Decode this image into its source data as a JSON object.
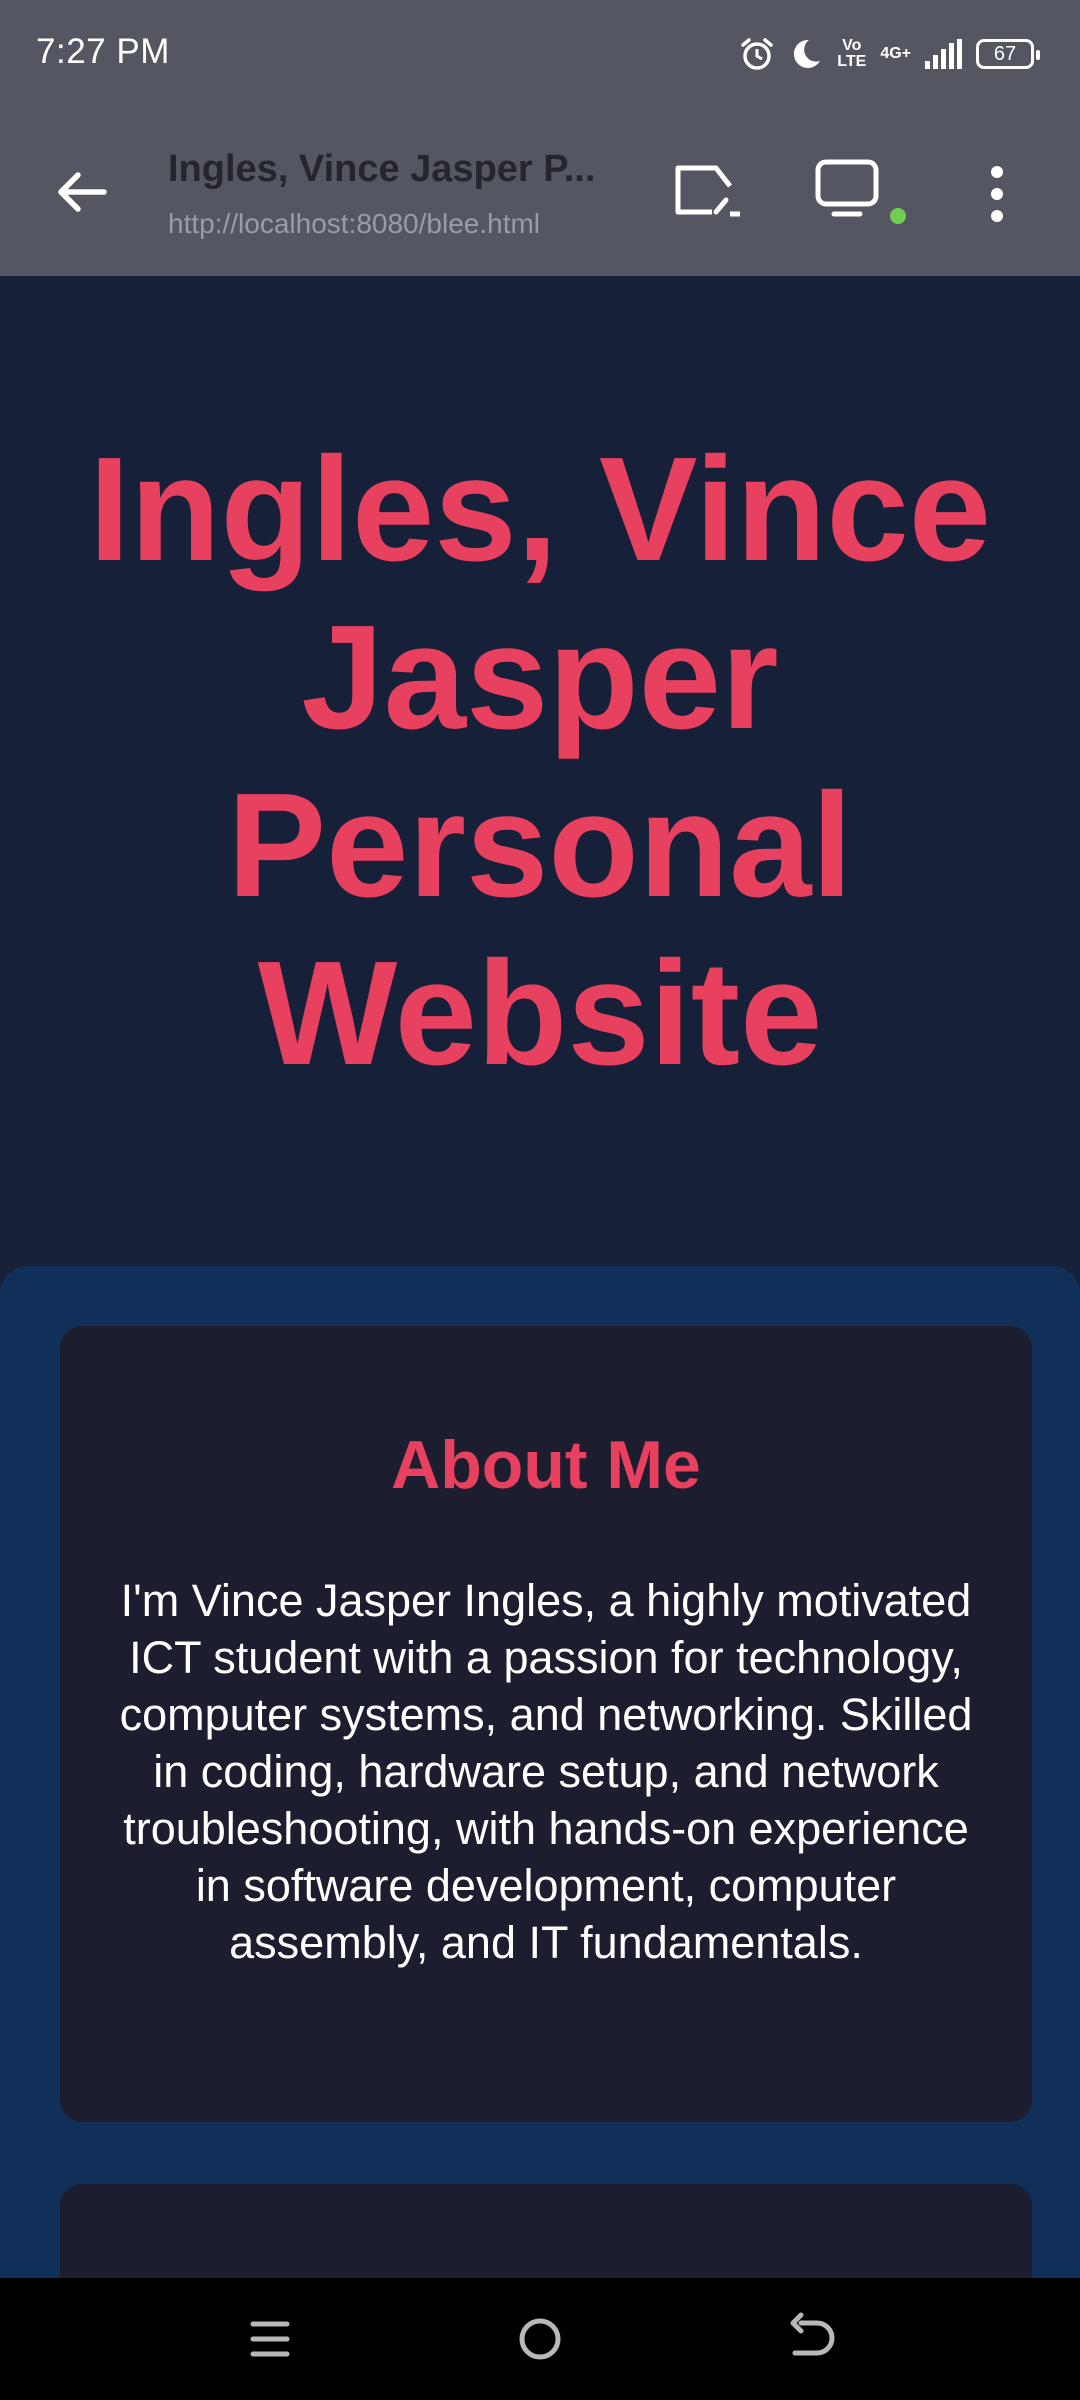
{
  "status_bar": {
    "time": "7:27 PM",
    "volte_top": "Vo",
    "volte_bottom": "LTE",
    "network": "4G+",
    "battery": "67"
  },
  "browser": {
    "title": "Ingles, Vince Jasper P...",
    "url": "http://localhost:8080/blee.html",
    "indicator_color": "#6fce4f"
  },
  "hero": {
    "title": "Ingles, Vince Jasper Personal Website"
  },
  "about": {
    "heading": "About Me",
    "text": "I'm Vince Jasper Ingles, a highly motivated ICT student with a passion for technology, computer systems, and networking. Skilled in coding, hardware setup, and network troubleshooting, with hands-on experience in software development, computer assembly, and IT fundamentals."
  },
  "colors": {
    "accent": "#e8405f",
    "hero_bg": "#172039",
    "section_bg": "#10305a",
    "card_bg": "#1d1d30",
    "chrome_bg": "#545761"
  },
  "icons": {
    "status": [
      "alarm-icon",
      "moon-icon",
      "signal-icon",
      "battery-icon"
    ],
    "browser": [
      "back-arrow-icon",
      "cast-icon",
      "tabs-icon",
      "more-vert-icon"
    ],
    "nav": [
      "recents-icon",
      "home-icon",
      "back-icon"
    ]
  }
}
